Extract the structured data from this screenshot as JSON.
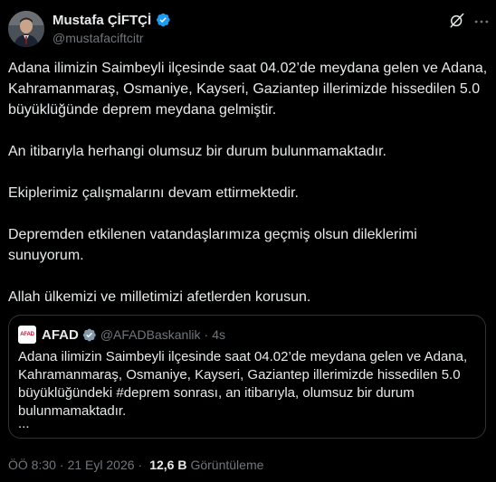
{
  "author": {
    "name": "Mustafa ÇİFTÇİ",
    "handle": "@mustafaciftcitr",
    "verified_color": "#1d9bf0"
  },
  "header_icons": [
    "grok-icon",
    "more-options-icon"
  ],
  "tweet": {
    "paragraphs": [
      "Adana ilimizin Saimbeyli ilçesinde saat 04.02’de meydana gelen ve Adana, Kahramanmaraş, Osmaniye, Kayseri, Gaziantep illerimizde hissedilen 5.0 büyüklüğünde deprem meydana gelmiştir.",
      "An itibarıyla herhangi olumsuz bir durum bulunmamaktadır.",
      "Ekiplerimiz çalışmalarını devam ettirmektedir.",
      "Depremden etkilenen vatandaşlarımıza geçmiş olsun dileklerimi sunuyorum.",
      "Allah ülkemizi ve milletimizi afetlerden korusun."
    ]
  },
  "quote": {
    "avatar_text": "AFAD",
    "name": "AFAD",
    "handle": "@AFADBaskanlik",
    "dot": "·",
    "time": "4s",
    "text": "Adana ilimizin Saimbeyli ilçesinde saat 04.02’de meydana gelen ve Adana, Kahramanmaraş, Osmaniye, Kayseri, Gaziantep illerimizde hissedilen 5.0 büyüklüğündeki #deprem sonrası, an itibarıyla, olumsuz bir durum bulunmamaktadır.",
    "ellipsis": "..."
  },
  "meta": {
    "time": "ÖÖ 8:30",
    "sep": "·",
    "date": "21 Eyl 2026",
    "sep2": "·",
    "views_count": "12,6 B",
    "views_label": "Görüntüleme"
  },
  "colors": {
    "background": "#000000",
    "text": "#e7e9ea",
    "secondary": "#71767b",
    "border": "#2f3336",
    "accent": "#1d9bf0"
  }
}
